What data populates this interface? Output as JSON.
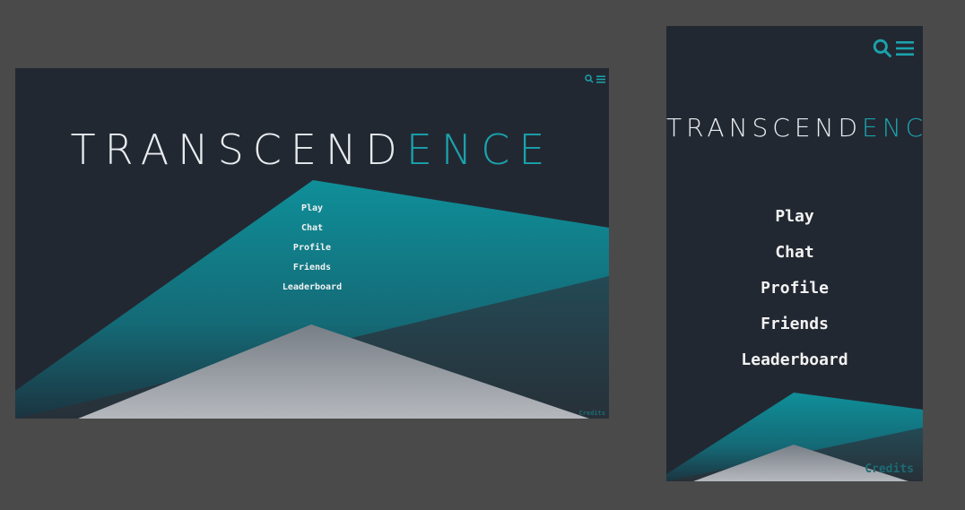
{
  "app": {
    "title_main": "TRANSCEND",
    "title_accent": "ENCE"
  },
  "menu": {
    "items": [
      "Play",
      "Chat",
      "Profile",
      "Friends",
      "Leaderboard"
    ]
  },
  "footer": {
    "credits_label": "Credits"
  },
  "header": {
    "icons": [
      "search-icon",
      "hamburger-menu-icon"
    ]
  },
  "colors": {
    "canvas": "#4a4a4a",
    "background": "#222832",
    "accent": "#1aa3ad",
    "text": "#f2f2f2",
    "peak": "#8a9098"
  }
}
